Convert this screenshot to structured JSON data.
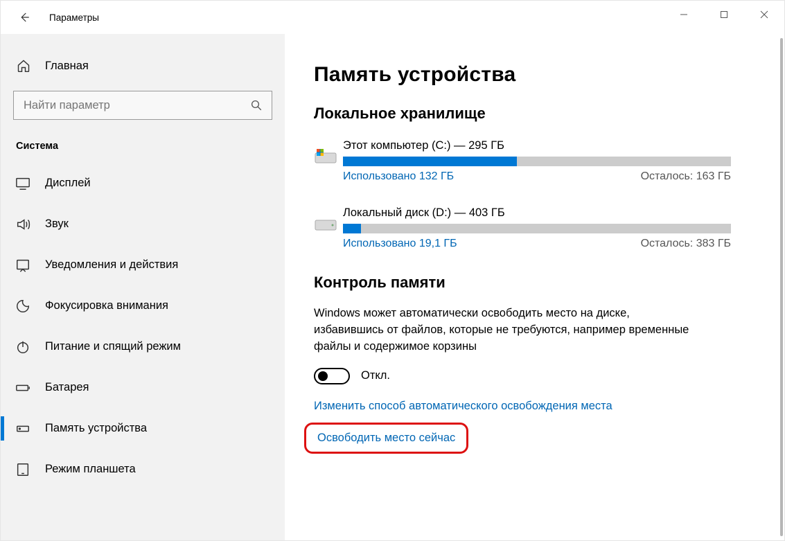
{
  "window": {
    "title": "Параметры"
  },
  "sidebar": {
    "home_label": "Главная",
    "search_placeholder": "Найти параметр",
    "section_label": "Система",
    "items": [
      {
        "label": "Дисплей"
      },
      {
        "label": "Звук"
      },
      {
        "label": "Уведомления и действия"
      },
      {
        "label": "Фокусировка внимания"
      },
      {
        "label": "Питание и спящий режим"
      },
      {
        "label": "Батарея"
      },
      {
        "label": "Память устройства"
      },
      {
        "label": "Режим планшета"
      }
    ],
    "active_index": 6
  },
  "main": {
    "heading": "Память устройства",
    "local_storage_heading": "Локальное хранилище",
    "drives": [
      {
        "name": "Этот компьютер (C:) — 295 ГБ",
        "used_label": "Использовано 132 ГБ",
        "free_label": "Осталось: 163 ГБ",
        "used_percent": 44.9
      },
      {
        "name": "Локальный диск (D:) — 403 ГБ",
        "used_label": "Использовано 19,1 ГБ",
        "free_label": "Осталось: 383 ГБ",
        "used_percent": 4.7
      }
    ],
    "storage_sense_heading": "Контроль памяти",
    "storage_sense_desc": "Windows может автоматически освободить место на диске, избавившись от файлов, которые не требуются, например временные файлы и содержимое корзины",
    "toggle_state_label": "Откл.",
    "link_change": "Изменить способ автоматического освобождения места",
    "link_free_now": "Освободить место сейчас"
  }
}
